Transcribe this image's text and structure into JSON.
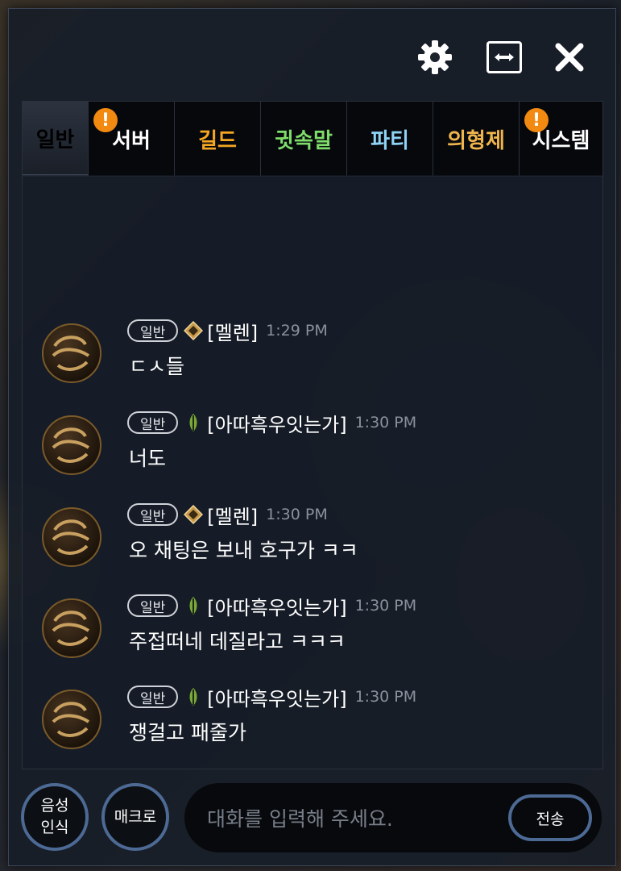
{
  "toolbar": {
    "settings_icon": "gear-icon",
    "resize_icon": "resize-horizontal-icon",
    "close_icon": "close-icon"
  },
  "tabs": [
    {
      "label": "일반",
      "color": "#ffffff",
      "active": true,
      "alert": false
    },
    {
      "label": "서버",
      "color": "#ffffff",
      "active": false,
      "alert": true
    },
    {
      "label": "길드",
      "color": "#f5a623",
      "active": false,
      "alert": false
    },
    {
      "label": "귓속말",
      "color": "#7ddc6a",
      "active": false,
      "alert": false
    },
    {
      "label": "파티",
      "color": "#8fd3f5",
      "active": false,
      "alert": false
    },
    {
      "label": "의형제",
      "color": "#f0b54c",
      "active": false,
      "alert": false
    },
    {
      "label": "시스템",
      "color": "#ffffff",
      "active": false,
      "alert": true
    }
  ],
  "alert_glyph": "!",
  "messages": [
    {
      "channel": "일반",
      "name": "[멜렌]",
      "time": "1:29 PM",
      "text": "ㄷㅅ들",
      "rank_icon": "diamond-rank-icon"
    },
    {
      "channel": "일반",
      "name": "[아따흑우잇는가]",
      "time": "1:30 PM",
      "text": "너도",
      "rank_icon": "leaf-rank-icon"
    },
    {
      "channel": "일반",
      "name": "[멜렌]",
      "time": "1:30 PM",
      "text": "오 채팅은 보내 호구가 ㅋㅋ",
      "rank_icon": "diamond-rank-icon"
    },
    {
      "channel": "일반",
      "name": "[아따흑우잇는가]",
      "time": "1:30 PM",
      "text": "주접떠네 데질라고 ㅋㅋㅋ",
      "rank_icon": "leaf-rank-icon"
    },
    {
      "channel": "일반",
      "name": "[아따흑우잇는가]",
      "time": "1:30 PM",
      "text": "쟁걸고 패줄가",
      "rank_icon": "leaf-rank-icon"
    }
  ],
  "bottom": {
    "voice_line1": "음성",
    "voice_line2": "인식",
    "macro_label": "매크로",
    "input_placeholder": "대화를 입력해 주세요.",
    "input_value": "",
    "send_label": "전송"
  }
}
